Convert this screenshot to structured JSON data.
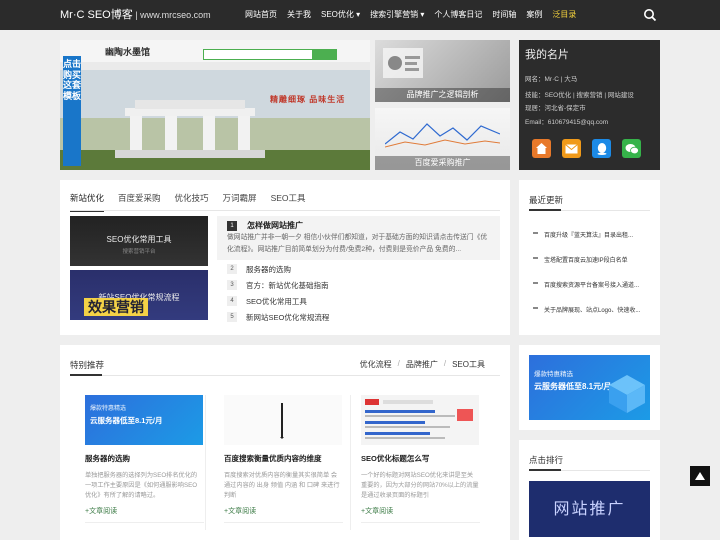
{
  "header": {
    "logo_text": "Mr·C SEO博客",
    "logo_sep": " | ",
    "logo_domain": "www.mrcseo.com",
    "nav": [
      {
        "label": "网站首页"
      },
      {
        "label": "关于我"
      },
      {
        "label": "SEO优化 ▾"
      },
      {
        "label": "搜索引擎营销 ▾"
      },
      {
        "label": "个人博客日记"
      },
      {
        "label": "时间轴"
      },
      {
        "label": "案例"
      },
      {
        "label": "泛目录"
      }
    ],
    "search_icon": "search-icon"
  },
  "banner": {
    "side_text": "点击购买这套模板",
    "site_name": "幽陶水墨馆",
    "slogan": "精雕细琢 品味生活",
    "dots": 4
  },
  "thumbs": [
    {
      "caption": "品牌推广之逻辑剖析"
    },
    {
      "caption": "百度爱采购推广"
    }
  ],
  "profile": {
    "title": "我的名片",
    "lines": [
      "网名：Mr·C | 大马",
      "技能：SEO优化 | 搜索营销 | 网站建设",
      "现居：河北省-保定市",
      "Email：610679415@qq.com"
    ],
    "icons": [
      "home-icon",
      "mail-icon",
      "qq-icon",
      "wechat-icon"
    ]
  },
  "news": {
    "tabs": [
      "新站优化",
      "百度爱采购",
      "优化技巧",
      "万词霸屏",
      "SEO工具"
    ],
    "images": [
      {
        "caption": "SEO优化常用工具",
        "sub": "搜索营销平台"
      },
      {
        "caption": "新站SEO优化常规流程",
        "overlay": "效果营销"
      }
    ],
    "featured": {
      "rank": "1",
      "title": "怎样做网站推广",
      "text": "做网站推广并非一朝一夕 相信小伙伴们都知道，对于基础方面的知识请点击传送门《优化流程》。网站推广目前简单划分为付费/免费2种，付费则是竞价产品 免费的..."
    },
    "list": [
      {
        "rank": "2",
        "title": "服务器的选购"
      },
      {
        "rank": "3",
        "title": "官方：新站优化基础指南"
      },
      {
        "rank": "4",
        "title": "SEO优化常用工具"
      },
      {
        "rank": "5",
        "title": "新网站SEO优化常规流程"
      }
    ]
  },
  "recent": {
    "title": "最近更新",
    "items": [
      "百度升级『蓝天算法』目录出租...",
      "宝塔配置百度云加速IP段白名单",
      "百度搜索资源平台备案号接入通道...",
      "关于品牌展现、站点Logo、快速收..."
    ]
  },
  "special": {
    "title": "特别推荐",
    "cats": [
      "优化流程",
      "品牌推广",
      "SEO工具"
    ],
    "articles": [
      {
        "title": "服务器的选购",
        "desc": "单独把服务器的选择列为SEO排名优化的一项工作主要原因是《如何通服影响SEO优化》有所了解的请略过。",
        "more": "+文章阅读",
        "img_l1": "爆款特惠精选",
        "img_l2": "云服务器低至8.1元/月"
      },
      {
        "title": "百度搜索衡量优质内容的维度",
        "desc": "百度搜索对优质内容的衡量其实很简单 会通过内容的 出身 频值 内涵 和 口碑 来进行判断",
        "more": "+文章阅读"
      },
      {
        "title": "SEO优化标题怎么写",
        "desc": "一个好的标题对网站SEO优化来讲是至关重要的，因为大部分的网站70%以上的流量是通过收录页面的标题引",
        "more": "+文章阅读"
      }
    ]
  },
  "side_ad": {
    "line1": "爆款特惠精选",
    "line2": "云服务器低至8.1元/月"
  },
  "hot": {
    "title": "点击排行",
    "img_caption": "网站推广"
  },
  "colors": {
    "topbar": "#2b2b2b",
    "accent_nav": "#f5d33c",
    "home_icon_bg": "#e8792a",
    "mail_icon_bg": "#f09a1a",
    "qq_icon_bg": "#1c8ae6",
    "wechat_icon_bg": "#36b34a"
  }
}
